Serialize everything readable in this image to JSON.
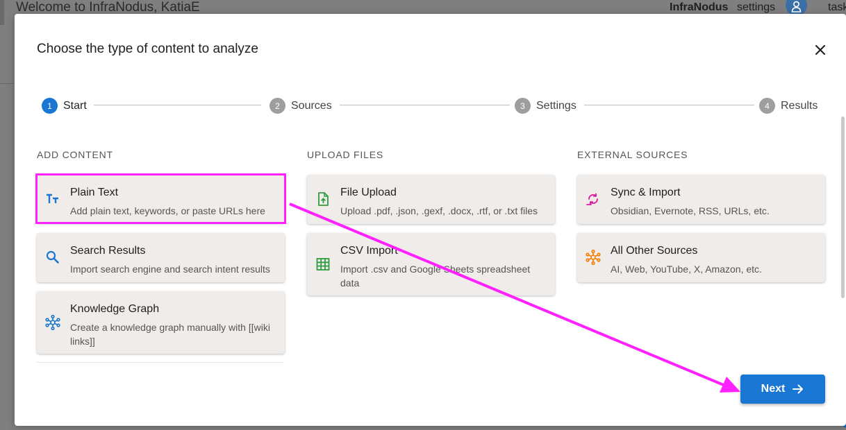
{
  "background": {
    "title": "Welcome to InfraNodus, KatiaE",
    "brand": "InfraNodus",
    "settings": "settings",
    "tasks": "task"
  },
  "modal": {
    "title": "Choose the type of content to analyze",
    "close_icon": "close-icon"
  },
  "stepper": [
    {
      "number": "1",
      "label": "Start",
      "active": true
    },
    {
      "number": "2",
      "label": "Sources",
      "active": false
    },
    {
      "number": "3",
      "label": "Settings",
      "active": false
    },
    {
      "number": "4",
      "label": "Results",
      "active": false
    }
  ],
  "sections": {
    "add_content": {
      "title": "ADD CONTENT",
      "cards": [
        {
          "title": "Plain Text",
          "desc": "Add plain text, keywords, or paste URLs here",
          "icon": "text-format-icon"
        },
        {
          "title": "Search Results",
          "desc": "Import search engine and search intent results",
          "icon": "search-icon"
        },
        {
          "title": "Knowledge Graph",
          "desc": "Create a knowledge graph manually with [[wiki links]]",
          "icon": "hub-icon"
        }
      ]
    },
    "upload_files": {
      "title": "UPLOAD FILES",
      "cards": [
        {
          "title": "File Upload",
          "desc": "Upload .pdf, .json, .gexf, .docx, .rtf, or .txt files",
          "icon": "file-upload-icon"
        },
        {
          "title": "CSV Import",
          "desc": "Import .csv and Google Sheets spreadsheet data",
          "icon": "grid-icon"
        }
      ]
    },
    "external_sources": {
      "title": "EXTERNAL SOURCES",
      "cards": [
        {
          "title": "Sync & Import",
          "desc": "Obsidian, Evernote, RSS, URLs, etc.",
          "icon": "sync-icon"
        },
        {
          "title": "All Other Sources",
          "desc": "AI, Web, YouTube, X, Amazon, etc.",
          "icon": "network-icon"
        }
      ]
    }
  },
  "actions": {
    "next_label": "Next"
  },
  "colors": {
    "primary": "#1976d2",
    "highlight": "#ff22ff",
    "card_bg": "#f0ece9",
    "upload_green": "#2e9d3f",
    "sync_magenta": "#d81b9c",
    "other_orange": "#f57c00"
  }
}
